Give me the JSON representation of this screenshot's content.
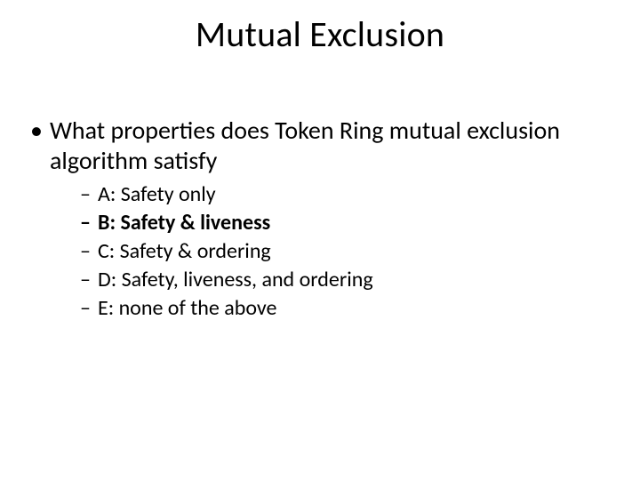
{
  "slide": {
    "title": "Mutual Exclusion",
    "question": "What properties does Token Ring mutual exclusion algorithm satisfy",
    "options": [
      {
        "label": "A: Safety only",
        "bold": false
      },
      {
        "label": "B: Safety & liveness",
        "bold": true
      },
      {
        "label": "C: Safety & ordering",
        "bold": false
      },
      {
        "label": "D: Safety, liveness, and ordering",
        "bold": false
      },
      {
        "label": "E: none of the above",
        "bold": false
      }
    ]
  }
}
